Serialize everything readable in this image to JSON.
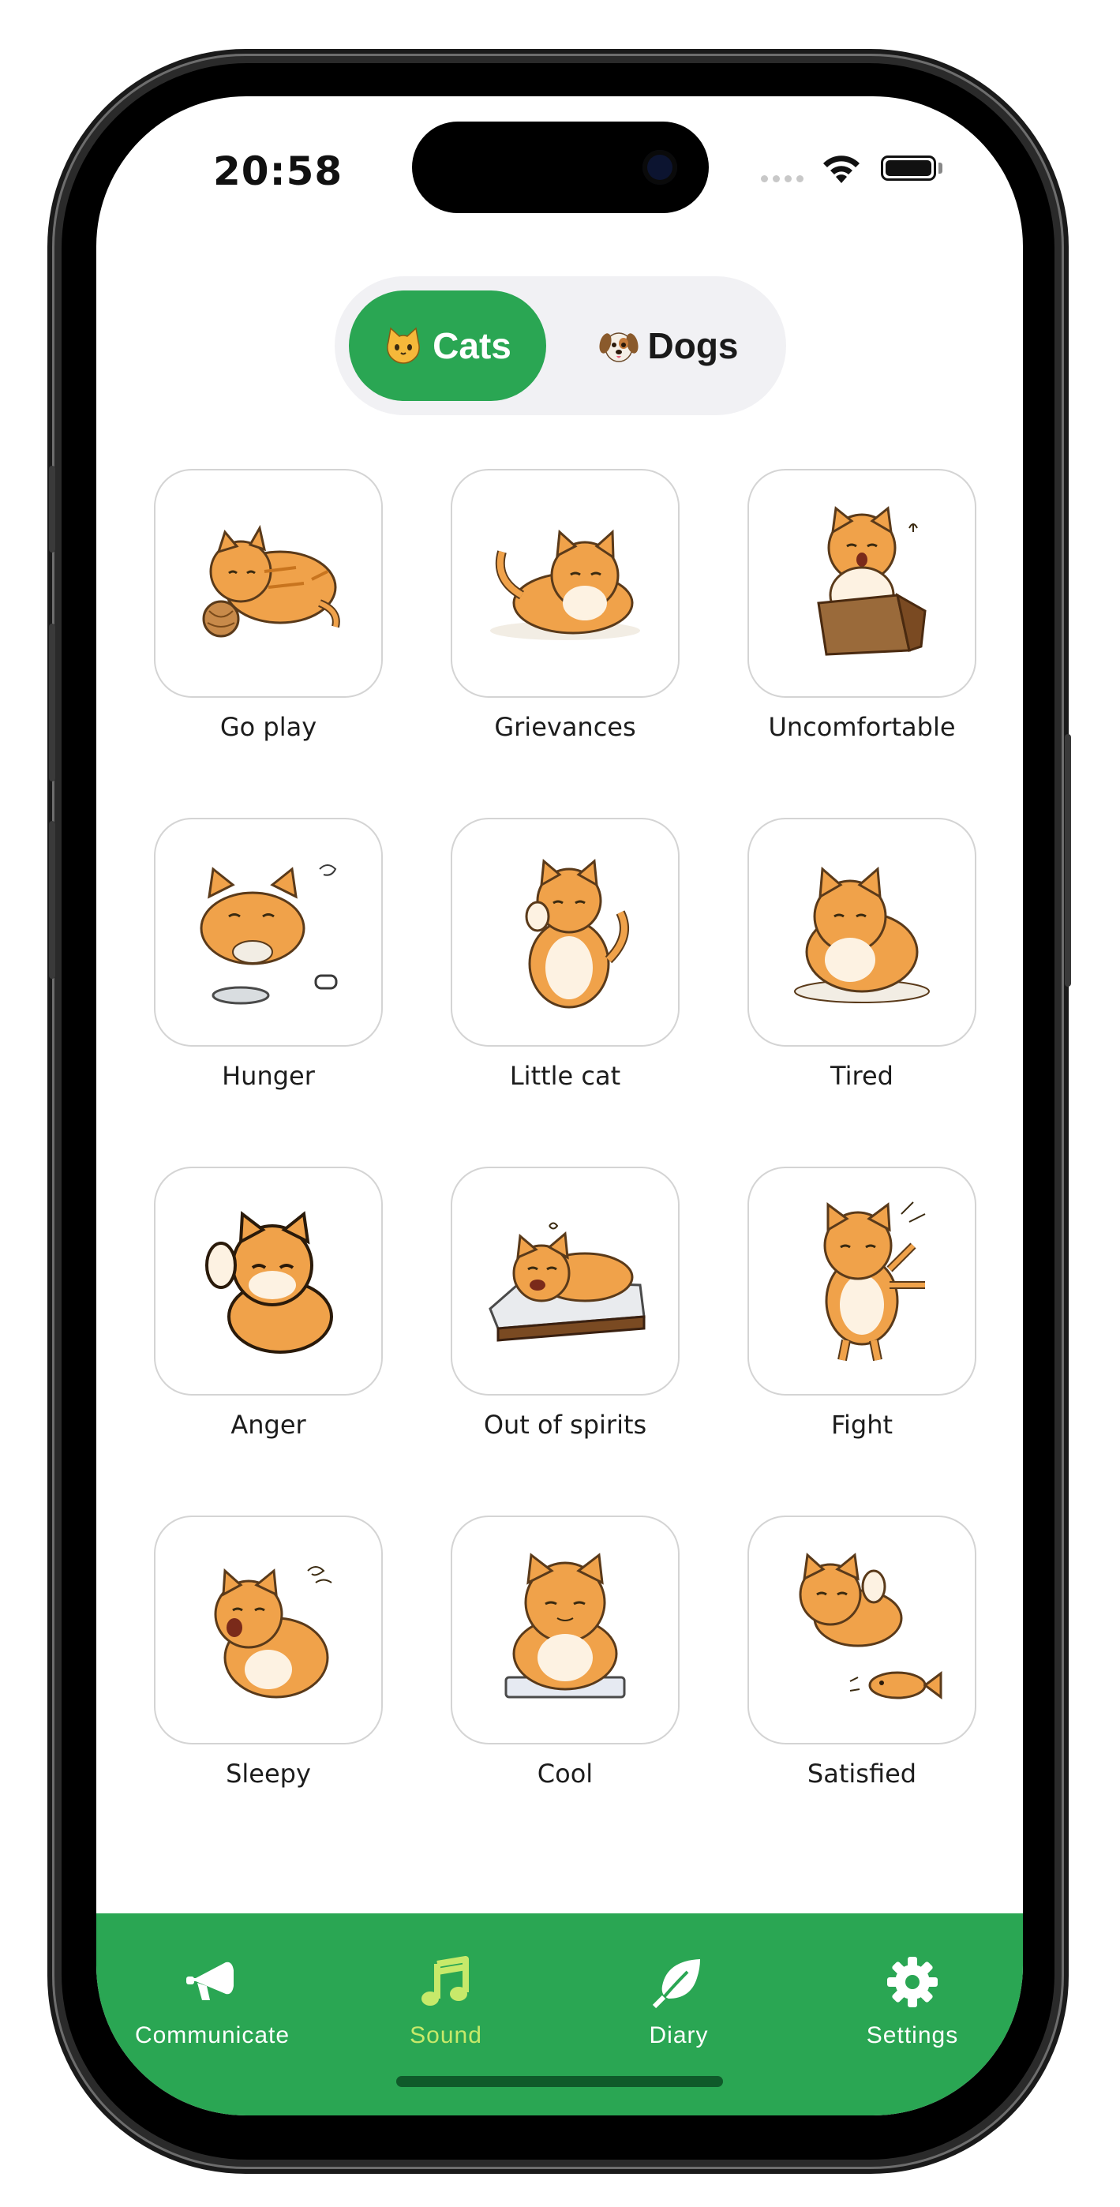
{
  "status_bar": {
    "time": "20:58"
  },
  "segment": {
    "options": [
      {
        "emoji_name": "cat-face-icon",
        "label": "Cats",
        "selected": true
      },
      {
        "emoji_name": "dog-face-icon",
        "label": "Dogs",
        "selected": false
      }
    ],
    "active_color": "#2aa653"
  },
  "sounds": [
    {
      "label": "Go play",
      "icon": "cat-playing-yarn-icon"
    },
    {
      "label": "Grievances",
      "icon": "cat-lying-down-icon"
    },
    {
      "label": "Uncomfortable",
      "icon": "cat-in-box-icon"
    },
    {
      "label": "Hunger",
      "icon": "cat-with-bowl-icon"
    },
    {
      "label": "Little cat",
      "icon": "cat-sitting-icon"
    },
    {
      "label": "Tired",
      "icon": "cat-resting-icon"
    },
    {
      "label": "Anger",
      "icon": "cat-waving-icon"
    },
    {
      "label": "Out of spirits",
      "icon": "cat-on-bed-icon"
    },
    {
      "label": "Fight",
      "icon": "cat-jumping-icon"
    },
    {
      "label": "Sleepy",
      "icon": "cat-yawning-icon"
    },
    {
      "label": "Cool",
      "icon": "cat-sitting-front-icon"
    },
    {
      "label": "Satisfied",
      "icon": "cat-with-fish-icon"
    }
  ],
  "tabbar": {
    "color": "#2aa653",
    "active_label_color": "#c7e96a",
    "items": [
      {
        "label": "Communicate",
        "icon": "megaphone-icon",
        "active": false
      },
      {
        "label": "Sound",
        "icon": "music-note-icon",
        "active": true
      },
      {
        "label": "Diary",
        "icon": "leaf-icon",
        "active": false
      },
      {
        "label": "Settings",
        "icon": "gear-icon",
        "active": false
      }
    ]
  }
}
